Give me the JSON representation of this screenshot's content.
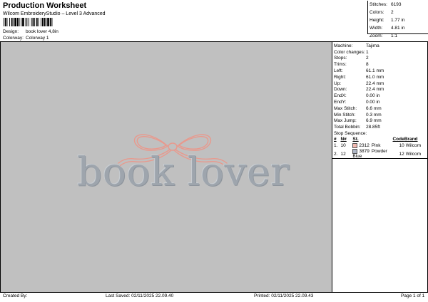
{
  "header": {
    "title": "Production Worksheet",
    "software": "Wilcom EmbroideryStudio – Level 3 Advanced",
    "design_label": "Design:",
    "design_value": "book lover 4,8in",
    "colorway_label": "Colorway:",
    "colorway_value": "Colorway 1"
  },
  "stats": [
    {
      "label": "Stitches:",
      "value": "6193"
    },
    {
      "label": "Colors:",
      "value": "2"
    },
    {
      "label": "Height:",
      "value": "1.77 in"
    },
    {
      "label": "Width:",
      "value": "4.81 in"
    },
    {
      "label": "Zoom:",
      "value": "1:1"
    }
  ],
  "machine_info": [
    {
      "label": "Machine:",
      "value": "Tajima"
    },
    {
      "label": "Color changes:",
      "value": "1"
    },
    {
      "label": "Stops:",
      "value": "2"
    },
    {
      "label": "Trims:",
      "value": "8"
    },
    {
      "label": "Left:",
      "value": "61.1 mm"
    },
    {
      "label": "Right:",
      "value": "61.0 mm"
    },
    {
      "label": "Up:",
      "value": "22.4 mm"
    },
    {
      "label": "Down:",
      "value": "22.4 mm"
    },
    {
      "label": "EndX:",
      "value": "0.00 in"
    },
    {
      "label": "EndY:",
      "value": "0.00 in"
    },
    {
      "label": "Max Stitch:",
      "value": "6.6 mm"
    },
    {
      "label": "Min Stitch:",
      "value": "0.3 mm"
    },
    {
      "label": "Max Jump:",
      "value": "6.9 mm"
    },
    {
      "label": "Total Bobbin:",
      "value": "28.85ft"
    }
  ],
  "stop_sequence": {
    "heading": "Stop Sequence:",
    "columns": [
      "#",
      "N#",
      "St.",
      "Code",
      "Brand"
    ],
    "rows": [
      {
        "idx": "1.",
        "n": "10",
        "color": "#f2b9b0",
        "code_num": "2312",
        "name": "Pink",
        "st": "10",
        "brand": "Wilcom"
      },
      {
        "idx": "2.",
        "n": "12",
        "color": "#aeb6c6",
        "code_num": "3879",
        "name": "Powder Blue",
        "st": "12",
        "brand": "Wilcom"
      }
    ]
  },
  "design_preview": {
    "text": "book lover",
    "bow_color": "#e8998d",
    "text_color": "#9ea5ad",
    "background": "#c0c0c0"
  },
  "footer": {
    "created_by": "Created By:",
    "last_saved": "Last Saved: 02/11/2025 22.09.40",
    "printed": "Printed: 02/11/2025 22.09.43",
    "page": "Page 1 of 1"
  }
}
